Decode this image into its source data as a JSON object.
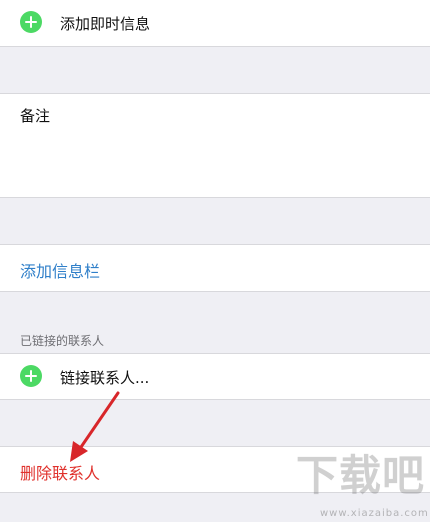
{
  "rows": {
    "add_instant_message": "添加即时信息",
    "notes_label": "备注",
    "add_field": "添加信息栏",
    "linked_contacts_header": "已链接的联系人",
    "link_contact": "链接联系人...",
    "delete_contact": "删除联系人"
  },
  "watermark": {
    "brand": "下载吧",
    "site": "www.xiazaiba.com"
  },
  "colors": {
    "background": "#efeff4",
    "accent_blue": "#2f7fc9",
    "destructive_red": "#e0312c",
    "add_green": "#4cd964",
    "annotation_arrow": "#d8262a"
  },
  "icons": [
    "add-circle-icon",
    "annotation-arrow"
  ]
}
